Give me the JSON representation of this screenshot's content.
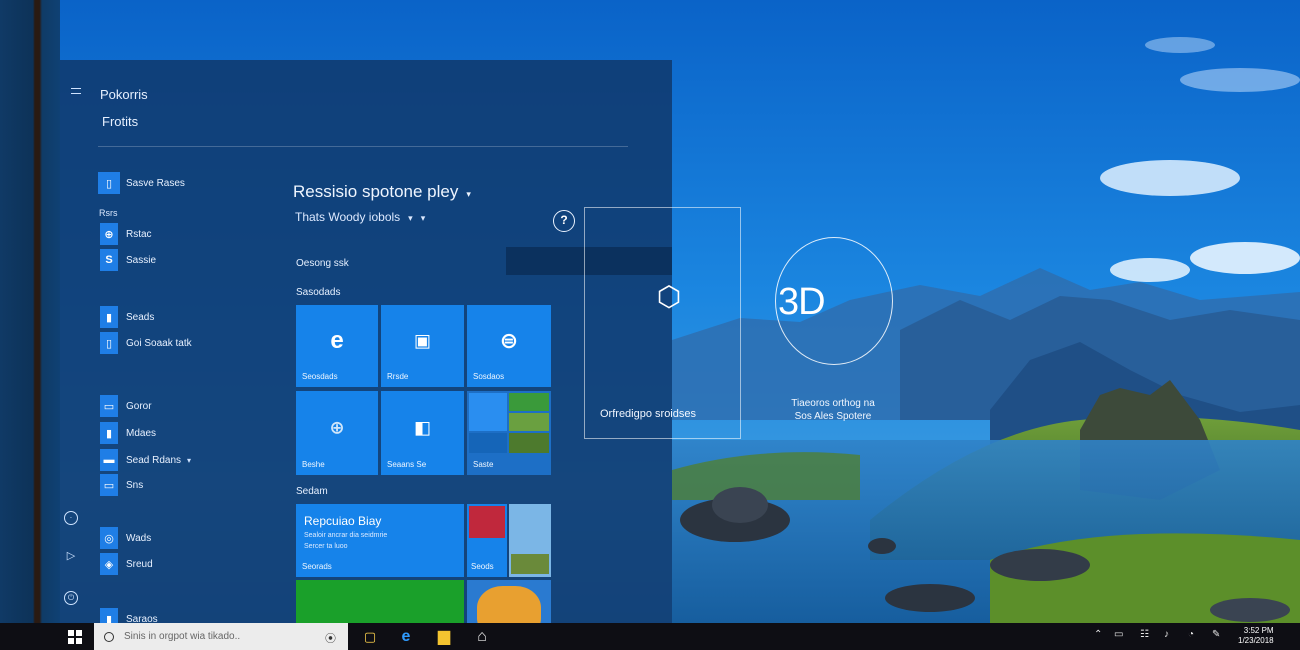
{
  "start_menu": {
    "header_line1": "Pokorris",
    "header_line2": "Frotits",
    "apps": [
      {
        "label": "Sasve Rases",
        "icon": "app-icon"
      },
      {
        "label": "Rsrs",
        "letter": true
      },
      {
        "label": "Rstac",
        "icon": "settings-icon"
      },
      {
        "label": "Sassie",
        "icon": "store-icon"
      },
      {
        "label": "Seads",
        "icon": "app-icon"
      },
      {
        "label": "Goi Soaak tatk",
        "icon": "app-icon"
      },
      {
        "label": "Goror",
        "icon": "app-icon"
      },
      {
        "label": "Mdaes",
        "icon": "app-icon"
      },
      {
        "label": "Sead Rdans",
        "icon": "app-icon"
      },
      {
        "label": "Sns",
        "icon": "app-icon"
      },
      {
        "label": "Wads",
        "icon": "app-icon"
      },
      {
        "label": "Sreud",
        "icon": "app-icon"
      },
      {
        "label": "Saraos",
        "icon": "app-icon"
      }
    ],
    "pane_title": "Ressisio spotone pley",
    "pane_subtitle": "Thats Woody iobols",
    "group_1": "Oesong ssk",
    "group_2": "Sasodads",
    "group_3": "Sedam",
    "tiles": [
      {
        "label": "Seosdads",
        "icon": "edge-icon"
      },
      {
        "label": "Rrsde",
        "icon": "calendar-icon"
      },
      {
        "label": "Sosdaos",
        "icon": "xbox-icon"
      },
      {
        "label": "Beshe",
        "icon": "globe-icon"
      },
      {
        "label": "Seaans Se",
        "icon": "store-icon"
      },
      {
        "label": "Saste",
        "icon": "photos-icon"
      }
    ],
    "wide_tile": {
      "title": "Repcuiao Biay",
      "line1": "Sealoir ancrar dia seidmrie",
      "line2": "Sercer ta luoo",
      "label": "Seorads"
    },
    "tile_misc": {
      "label": "Seods"
    }
  },
  "desktop": {
    "overlay_text": "Orfredigpo sroidses",
    "badge_text": "3D",
    "caption_line1": "Tiaeoros orthog na",
    "caption_line2": "Sos Ales Spotere"
  },
  "taskbar": {
    "search_placeholder": "Sinis in orgpot wia tikado..",
    "clock_time": "3:52 PM",
    "clock_date": "1/23/2018"
  },
  "colors": {
    "tile_blue": "#1683ea",
    "tile_green": "#1aa02a",
    "panel": "#103a6e",
    "taskbar": "#0e0e14"
  }
}
